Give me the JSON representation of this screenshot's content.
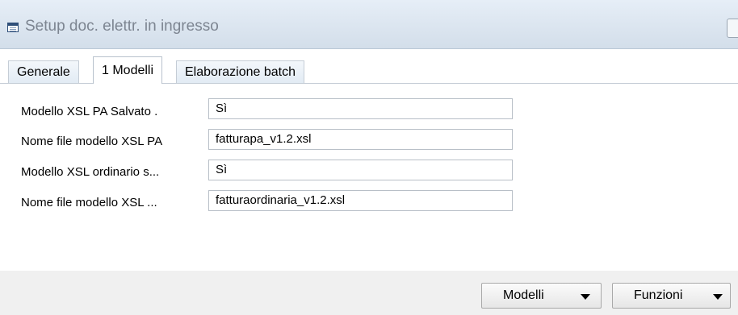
{
  "window": {
    "title": "Setup doc. elettr. in ingresso",
    "title_icon": "form-icon"
  },
  "tabs": [
    {
      "label": "Generale",
      "active": false
    },
    {
      "label": "1 Modelli",
      "active": true
    },
    {
      "label": "Elaborazione batch",
      "active": false
    }
  ],
  "fields": [
    {
      "label": "Modello XSL PA Salvato  .",
      "value": "Sì"
    },
    {
      "label": "Nome file modello XSL PA",
      "value": "fatturapa_v1.2.xsl"
    },
    {
      "label": "Modello XSL ordinario s...",
      "value": "Sì"
    },
    {
      "label": "Nome file modello XSL ...",
      "value": "fatturaordinaria_v1.2.xsl"
    }
  ],
  "footer": {
    "modelli_label": "Modelli",
    "funzioni_label": "Funzioni",
    "dropdown_icon": "chevron-down-icon"
  },
  "colors": {
    "titlebar": "#d3deea",
    "title_text": "#7d8591",
    "footer": "#f0f0f0"
  }
}
